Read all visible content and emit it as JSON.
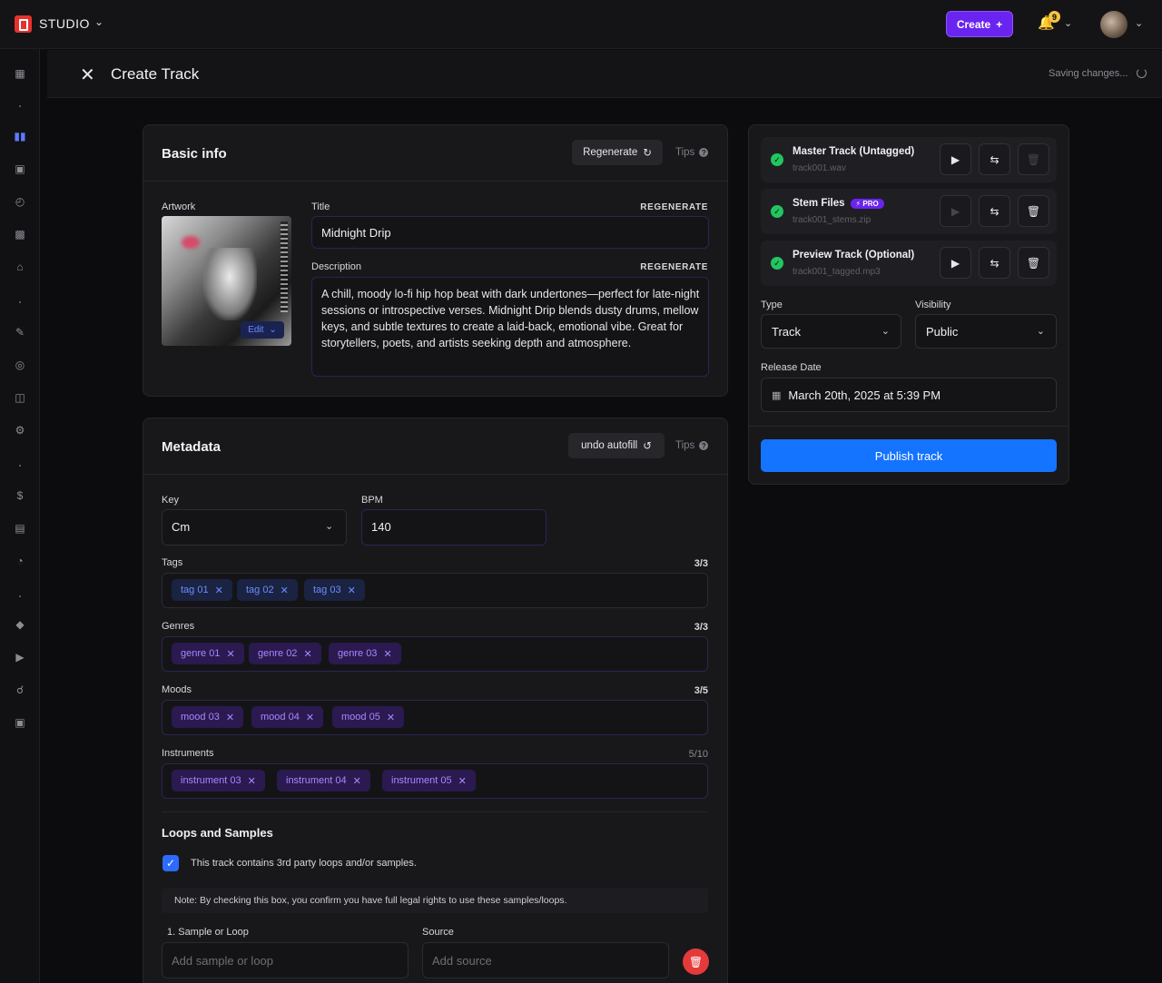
{
  "topbar": {
    "studio_label": "STUDIO",
    "create_label": "Create",
    "notifications_count": "9"
  },
  "header": {
    "title": "Create Track",
    "saving_text": "Saving changes..."
  },
  "basic_info": {
    "title": "Basic info",
    "regenerate_label": "Regenerate",
    "tips_label": "Tips",
    "artwork_label": "Artwork",
    "edit_label": "Edit",
    "title_label": "Title",
    "title_regen": "REGENERATE",
    "title_value": "Midnight Drip",
    "description_label": "Description",
    "description_regen": "REGENERATE",
    "description_value": "A chill, moody lo-fi hip hop beat with dark undertones—perfect for late-night sessions or introspective verses. Midnight Drip blends dusty drums, mellow keys, and subtle textures to create a laid-back, emotional vibe. Great for storytellers, poets, and artists seeking depth and atmosphere."
  },
  "metadata": {
    "title": "Metadata",
    "undo_label": "undo autofill",
    "tips_label": "Tips",
    "key_label": "Key",
    "key_value": "Cm",
    "bpm_label": "BPM",
    "bpm_value": "140",
    "tags_label": "Tags",
    "tags_count": "3/3",
    "tags": [
      "tag 01",
      "tag 02",
      "tag 03"
    ],
    "genres_label": "Genres",
    "genres_count": "3/3",
    "genres": [
      "genre 01",
      "genre 02",
      "genre 03"
    ],
    "moods_label": "Moods",
    "moods_count": "3/5",
    "moods": [
      "mood 03",
      "mood 04",
      "mood 05"
    ],
    "instruments_label": "Instruments",
    "instruments_count": "5/10",
    "instruments": [
      "instrument 03",
      "instrument 04",
      "instrument 05"
    ],
    "loops_title": "Loops and Samples",
    "loops_checkbox_text": "This track contains 3rd party loops and/or samples.",
    "loops_note": "Note: By checking this box, you confirm you have full legal rights to use these samples/loops.",
    "sample_label": "1. Sample or Loop",
    "sample_placeholder": "Add sample or loop",
    "source_label": "Source",
    "source_placeholder": "Add source"
  },
  "files": [
    {
      "name": "Master Track (Untagged)",
      "file": "track001.wav",
      "pro": false
    },
    {
      "name": "Stem Files",
      "file": "track001_stems.zip",
      "pro": true,
      "pro_label": "PRO"
    },
    {
      "name": "Preview Track (Optional)",
      "file": "track001_tagged.mp3",
      "pro": false
    }
  ],
  "settings": {
    "type_label": "Type",
    "type_value": "Track",
    "visibility_label": "Visibility",
    "visibility_value": "Public",
    "release_label": "Release Date",
    "release_value": "March 20th, 2025 at 5:39 PM",
    "publish_label": "Publish track"
  },
  "colors": {
    "accent_purple": "#6a24f0",
    "publish_blue": "#1473ff",
    "success_green": "#22c55e",
    "danger_red": "#e53a3a"
  }
}
